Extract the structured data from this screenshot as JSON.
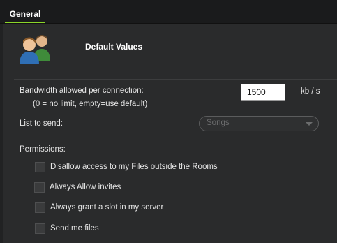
{
  "tabs": [
    {
      "label": "General"
    }
  ],
  "header": {
    "title": "Default Values",
    "icon": "users-icon"
  },
  "bandwidth": {
    "label": "Bandwidth allowed per connection:",
    "hint": "(0 = no limit, empty=use default)",
    "value": "1500",
    "unit": "kb / s"
  },
  "list_to_send": {
    "label": "List to send:",
    "selected": "Songs"
  },
  "permissions": {
    "label": "Permissions:",
    "items": [
      {
        "label": "Disallow access to my Files outside the Rooms",
        "checked": false
      },
      {
        "label": "Always Allow invites",
        "checked": false
      },
      {
        "label": "Always grant a slot in my server",
        "checked": false
      },
      {
        "label": "Send me files",
        "checked": false
      }
    ]
  }
}
